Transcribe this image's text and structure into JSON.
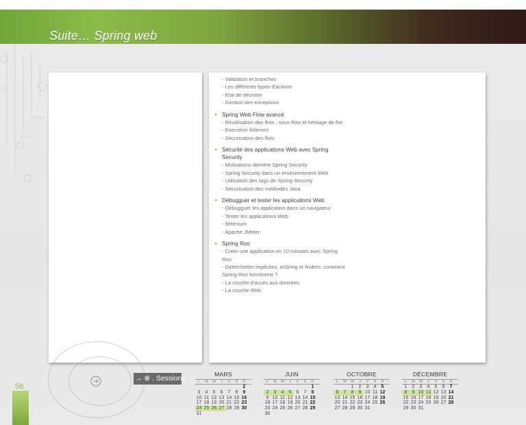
{
  "banner": {
    "title": "Suite… Spring web"
  },
  "page_number": "56",
  "sessions_button": {
    "label": "→ ⊕ . Sessions"
  },
  "content": {
    "intro_items": [
      "- Validation et branches",
      "- Les différents types d'actions",
      "- Etat de décision",
      "- Gestion des exceptions"
    ],
    "sections": [
      {
        "title": "Spring Web Flow avancé",
        "items": [
          "- Réutilisation des flots : sous-flots et héritage de flot",
          "- Execution listeners",
          "- Sécurisation des flots"
        ]
      },
      {
        "title": "Sécurité des applications Web avec Spring",
        "title2": "Security",
        "items": [
          "- Motivations derrière Spring Security",
          "- Spring Security dans un environnement Web",
          "- Utilisation des tags de Spring Security",
          "- Sécurisation des méthodes Java"
        ]
      },
      {
        "title": "Débugguer et tester les applications Web",
        "items": [
          "- Débugguer les application dans un navigateur",
          "- Tester les applications Web",
          "- Selenium",
          "- Apache JMeter"
        ]
      },
      {
        "title": "Spring Roo",
        "items": [
          "- Créer une application en 10 minutes avec Spring",
          "  Roo",
          "- Getter/setter implicites, toString et finders: comment",
          "  Spring Roo fonctionne ?",
          "- La couche d'accès aux données",
          "- La couche Web"
        ]
      }
    ]
  },
  "calendars": [
    {
      "month": "MARS",
      "weekdays": [
        "L",
        "M",
        "M",
        "J",
        "V",
        "S",
        "D"
      ],
      "days": [
        "",
        "",
        "",
        "",
        "",
        "",
        "2",
        "3",
        "4",
        "5",
        "6",
        "7",
        "8",
        "9",
        "10",
        "11",
        "12",
        "13",
        "14",
        "15",
        "16",
        "17",
        "18",
        "19",
        "20",
        "21",
        "22",
        "23",
        "24",
        "25",
        "26",
        "27",
        "28",
        "29",
        "30",
        "31"
      ],
      "highlighted": [
        "24",
        "25",
        "26",
        "27"
      ]
    },
    {
      "month": "JUIN",
      "weekdays": [
        "L",
        "M",
        "M",
        "J",
        "V",
        "S",
        "D"
      ],
      "days": [
        "",
        "",
        "",
        "",
        "",
        "",
        "1",
        "2",
        "3",
        "4",
        "5",
        "6",
        "7",
        "8",
        "9",
        "10",
        "11",
        "12",
        "13",
        "14",
        "15",
        "16",
        "17",
        "18",
        "19",
        "20",
        "21",
        "22",
        "23",
        "24",
        "25",
        "26",
        "27",
        "28",
        "29",
        "30"
      ],
      "highlighted": [
        "2",
        "3",
        "4",
        "5"
      ]
    },
    {
      "month": "OCTOBRE",
      "weekdays": [
        "L",
        "M",
        "M",
        "J",
        "V",
        "S",
        "D"
      ],
      "days": [
        "",
        "",
        "1",
        "2",
        "3",
        "4",
        "5",
        "6",
        "7",
        "8",
        "9",
        "10",
        "11",
        "12",
        "13",
        "14",
        "15",
        "16",
        "17",
        "18",
        "19",
        "20",
        "21",
        "22",
        "23",
        "24",
        "25",
        "26",
        "27",
        "28",
        "29",
        "30",
        "31"
      ],
      "highlighted": [
        "6",
        "7",
        "8",
        "9"
      ]
    },
    {
      "month": "DÉCEMBRE",
      "weekdays": [
        "L",
        "M",
        "M",
        "J",
        "V",
        "S",
        "D"
      ],
      "days": [
        "1",
        "2",
        "3",
        "4",
        "5",
        "6",
        "7",
        "8",
        "9",
        "10",
        "11",
        "12",
        "13",
        "14",
        "15",
        "16",
        "17",
        "18",
        "19",
        "20",
        "21",
        "22",
        "23",
        "24",
        "25",
        "26",
        "27",
        "28",
        "29",
        "30",
        "31"
      ],
      "highlighted": [
        "8",
        "9",
        "10",
        "11"
      ]
    }
  ],
  "colors": {
    "accent_green": "#8fb24c",
    "highlight": "#cfe39b",
    "banner_dark": "#2f1b16"
  }
}
